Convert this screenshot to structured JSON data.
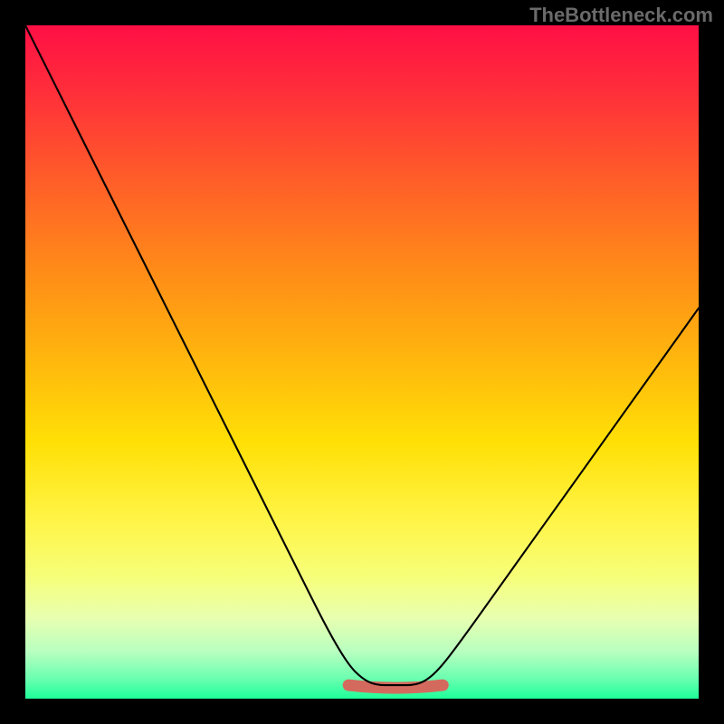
{
  "watermark": "TheBottleneck.com",
  "chart_data": {
    "type": "line",
    "title": "",
    "xlabel": "",
    "ylabel": "",
    "xlim": [
      0,
      100
    ],
    "ylim": [
      0,
      100
    ],
    "grid": false,
    "legend": false,
    "series": [
      {
        "name": "bottleneck-curve",
        "x": [
          0,
          5,
          10,
          15,
          20,
          25,
          30,
          35,
          40,
          45,
          48,
          50,
          52,
          55,
          58,
          60,
          62,
          65,
          70,
          75,
          80,
          85,
          90,
          95,
          100
        ],
        "y": [
          100,
          90,
          80,
          70,
          60,
          50,
          40,
          30,
          20,
          10,
          5,
          3,
          2,
          2,
          2,
          3,
          5,
          9,
          16,
          23,
          30,
          37,
          44,
          51,
          58
        ]
      }
    ],
    "highlight_band": {
      "name": "optimal-range",
      "x_start": 48,
      "x_end": 62,
      "y": 2,
      "color": "#d46a5e"
    }
  }
}
